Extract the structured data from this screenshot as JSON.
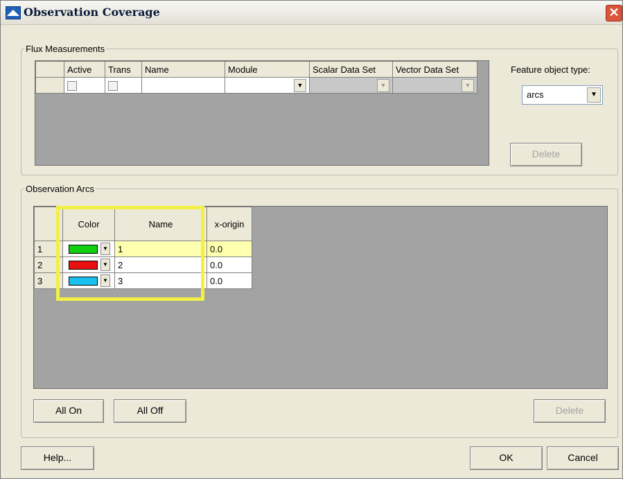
{
  "window": {
    "title": "Observation Coverage",
    "close_glyph": "✕"
  },
  "flux": {
    "group_label": "Flux Measurements",
    "columns": [
      "Active",
      "Trans",
      "Name",
      "Module",
      "Scalar Data Set",
      "Vector Data Set"
    ],
    "feature_label": "Feature object type:",
    "feature_value": "arcs",
    "delete_label": "Delete"
  },
  "arcs": {
    "group_label": "Observation Arcs",
    "columns": [
      "Color",
      "Name",
      "x-origin"
    ],
    "rows": [
      {
        "index": "1",
        "color": "#10d010",
        "name": "1",
        "x_origin": "0.0"
      },
      {
        "index": "2",
        "color": "#e81010",
        "name": "2",
        "x_origin": "0.0"
      },
      {
        "index": "3",
        "color": "#18c0f0",
        "name": "3",
        "x_origin": "0.0"
      }
    ],
    "all_on_label": "All On",
    "all_off_label": "All Off",
    "delete_label": "Delete"
  },
  "footer": {
    "help_label": "Help...",
    "ok_label": "OK",
    "cancel_label": "Cancel"
  },
  "colors": {
    "highlight": "#f2f045",
    "grid_bg": "#a3a3a3",
    "dialog_bg": "#ece9d8"
  }
}
